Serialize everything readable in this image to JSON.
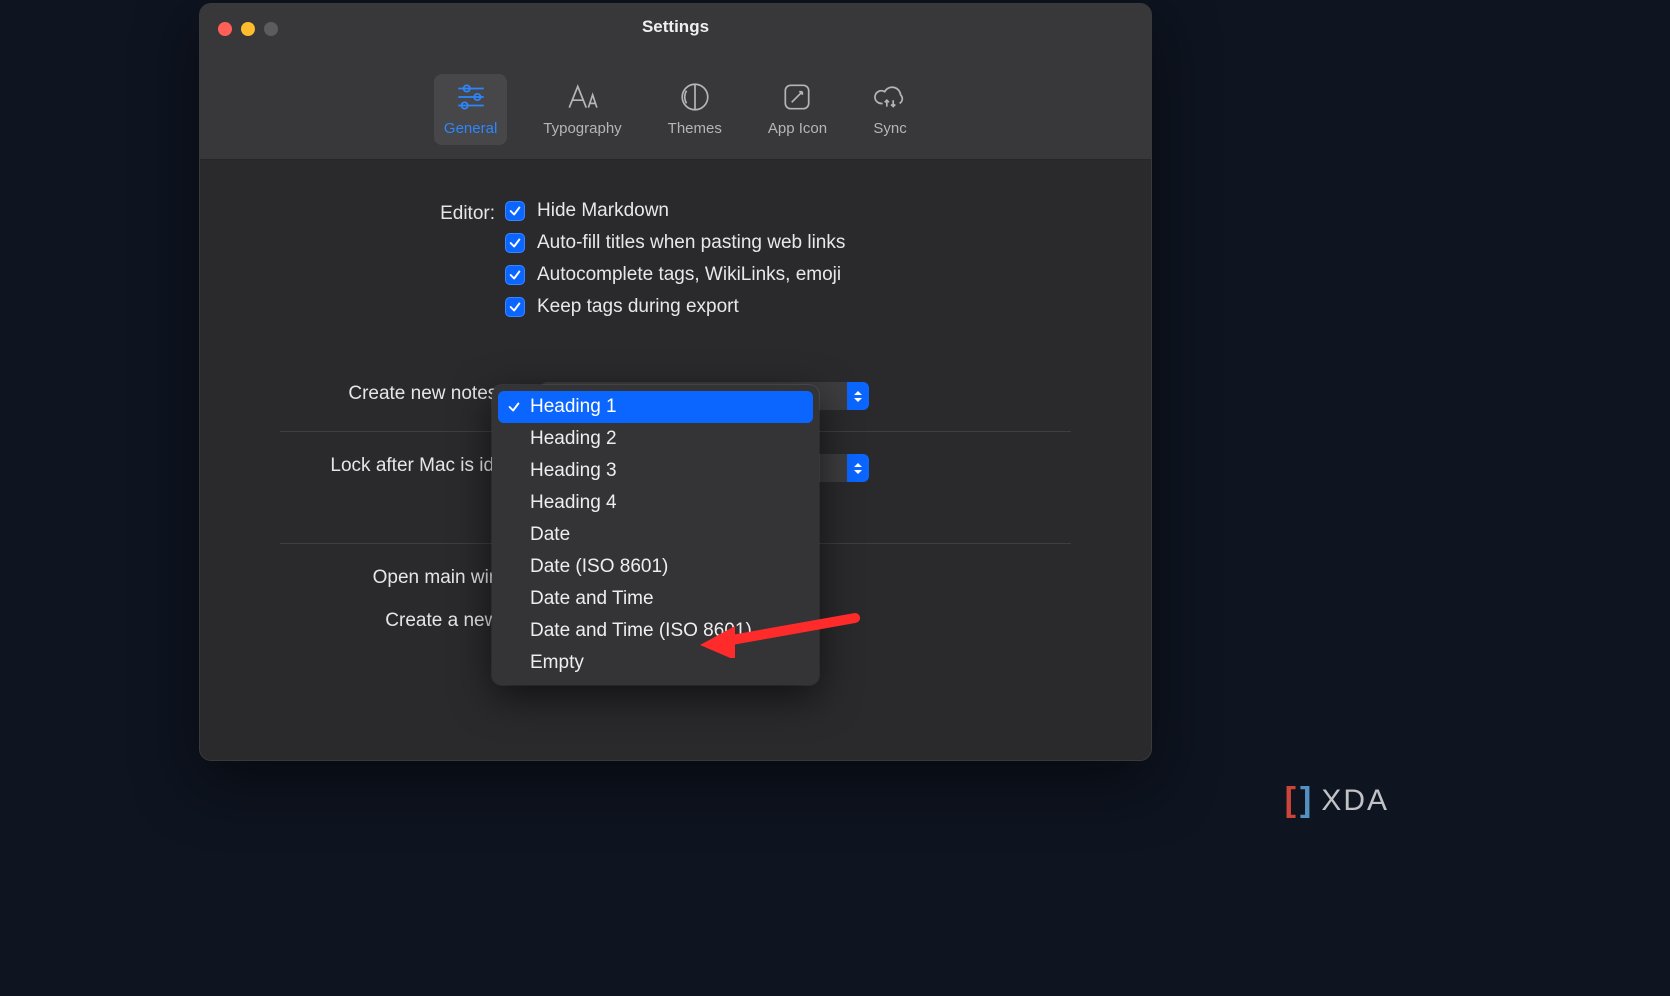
{
  "window": {
    "title": "Settings"
  },
  "toolbar": {
    "items": [
      {
        "label": "General"
      },
      {
        "label": "Typography"
      },
      {
        "label": "Themes"
      },
      {
        "label": "App Icon"
      },
      {
        "label": "Sync"
      }
    ]
  },
  "editor": {
    "section_label": "Editor:",
    "checks": {
      "hide_markdown": "Hide Markdown",
      "autofill_titles": "Auto-fill titles when pasting web links",
      "autocomplete_tags": "Autocomplete tags, WikiLinks, emoji",
      "keep_tags_export": "Keep tags during export"
    }
  },
  "create_row": {
    "label": "Create new notes witl"
  },
  "lock_row": {
    "label": "Lock after Mac is idle fo"
  },
  "open_row": {
    "label": "Open main windov"
  },
  "create_note_row": {
    "label": "Create a new not"
  },
  "dropdown": {
    "options": [
      "Heading 1",
      "Heading 2",
      "Heading 3",
      "Heading 4",
      "Date",
      "Date (ISO 8601)",
      "Date and Time",
      "Date and Time (ISO 8601)",
      "Empty"
    ],
    "selected_index": 0
  },
  "logo": {
    "text": "XDA"
  }
}
